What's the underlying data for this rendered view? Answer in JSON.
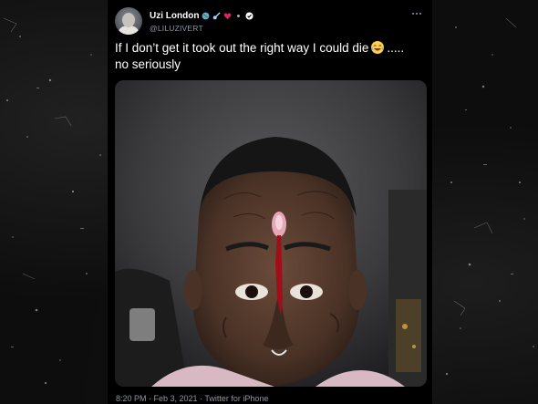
{
  "tweet": {
    "display_name": "Uzi London",
    "handle": "@LILUZIVERT",
    "text_line1_before": "If I don’t get it took out the right way I could die",
    "text_line1_after": ".....",
    "text_line2": "no seriously",
    "emoji": "face-with-tears-of-joy",
    "timestamp": "8:20 PM · Feb 3, 2021",
    "source": "Twitter for iPhone"
  },
  "media": {
    "subject": "selfie-photo"
  },
  "colors": {
    "card_bg": "#000000",
    "text_primary": "#ffffff",
    "text_secondary": "#8b98a5",
    "backdrop": "#0d0d0d",
    "verified": "#ffffff"
  }
}
